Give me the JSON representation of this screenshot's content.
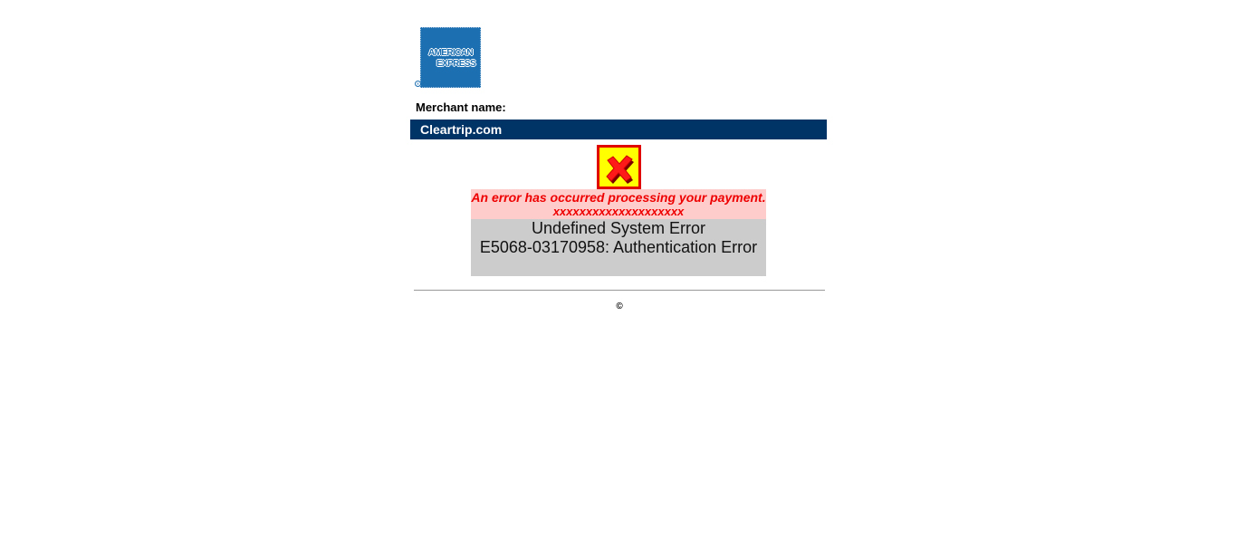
{
  "logo": {
    "line1": "AMERICAN",
    "line2": "EXPRESS",
    "reg_mark": "®",
    "icon": "american-express-logo"
  },
  "merchant": {
    "label": "Merchant name:",
    "name": "Cleartrip.com"
  },
  "error": {
    "icon": "error-x-icon",
    "message": "An error has occurred processing your payment.",
    "masked": "xxxxxxxxxxxxxxxxxxxx",
    "detail_line1": "Undefined System Error",
    "detail_line2": "E5068-03170958: Authentication Error"
  },
  "footer": {
    "copyright": "©"
  },
  "colors": {
    "brand_blue": "#1c6fb0",
    "merchant_bar": "#003366",
    "error_red": "#ee0000",
    "error_pink": "#ffcccc",
    "detail_grey": "#cccccc",
    "icon_yellow": "#ffff00"
  }
}
